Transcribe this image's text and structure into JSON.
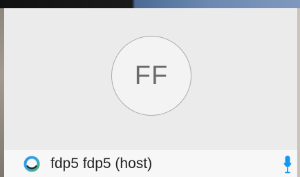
{
  "participant": {
    "initials": "FF",
    "name": "fdp5 fdp5 (host)"
  },
  "icons": {
    "presence": "presence-ring-icon",
    "mic": "microphone-icon"
  },
  "colors": {
    "tile_background": "#ebebeb",
    "name_bar_background": "#f7f7f7",
    "presence_ring_blue": "#2f95e8",
    "presence_ring_green": "#3fb06a",
    "mic_blue": "#1596f2"
  }
}
